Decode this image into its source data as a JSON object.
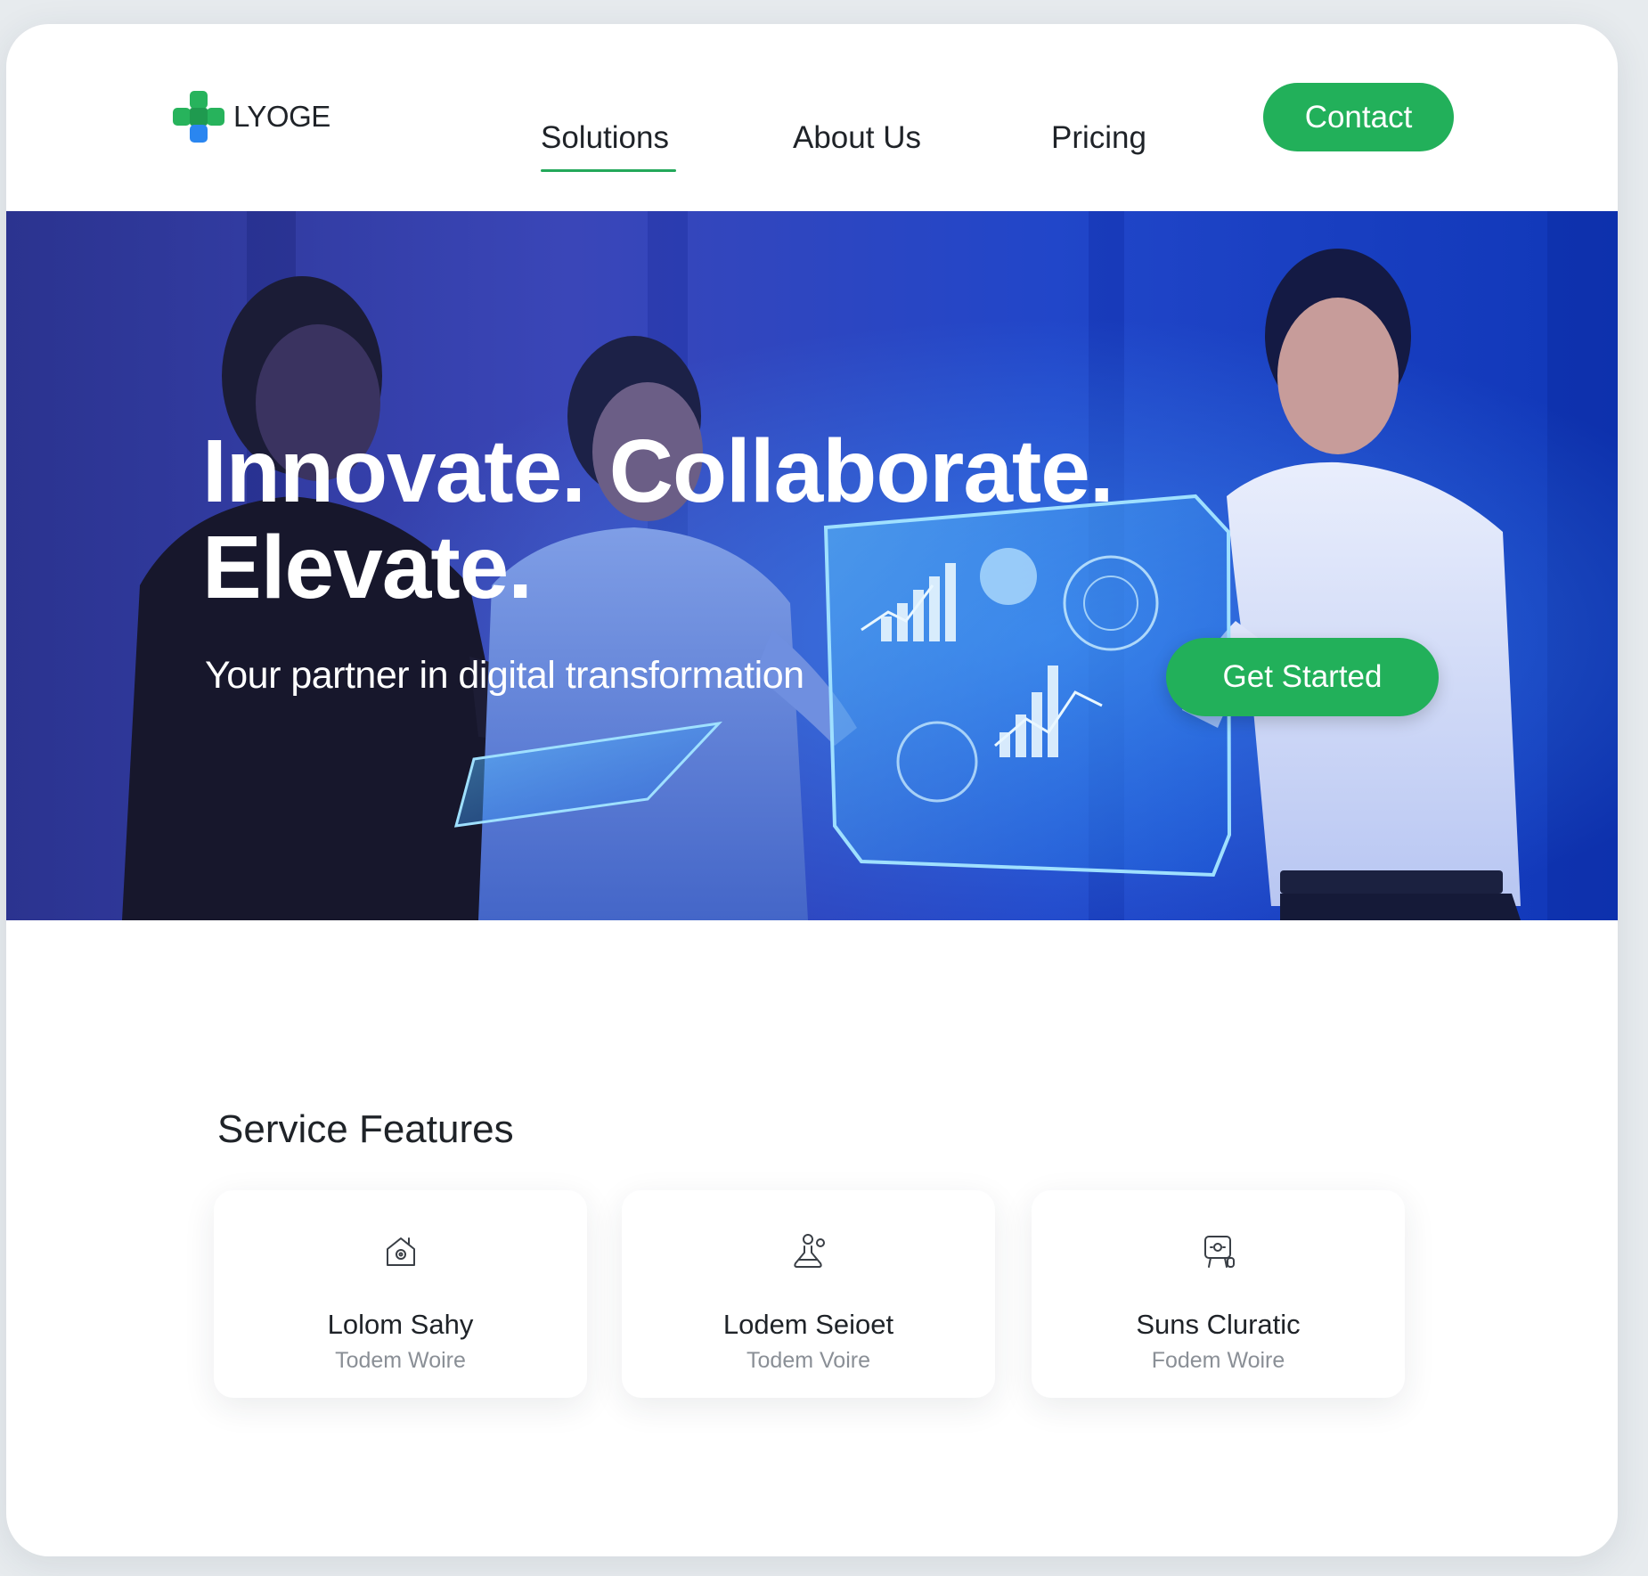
{
  "brand": {
    "name": "LYOGE",
    "logo_icon": "plus-cross-logo-icon",
    "logo_colors": [
      "#27b35c",
      "#2a86f0"
    ]
  },
  "nav": {
    "items": [
      {
        "label": "Solutions",
        "active": true
      },
      {
        "label": "About Us",
        "active": false
      },
      {
        "label": "Pricing",
        "active": false
      }
    ],
    "contact_label": "Contact"
  },
  "hero": {
    "title_line1": "Innovate. Collaborate.",
    "title_line2": "Elevate.",
    "subtitle": "Your partner in digital transformation",
    "cta_label": "Get Started",
    "image_icon": "team-hologram-photo"
  },
  "features": {
    "heading": "Service Features",
    "cards": [
      {
        "icon": "house-icon",
        "title": "Lolom Sahy",
        "desc": "Todem Woire"
      },
      {
        "icon": "user-flask-icon",
        "title": "Lodem Seioet",
        "desc": "Todem Voire"
      },
      {
        "icon": "device-settings-icon",
        "title": "Suns Cluratic",
        "desc": "Fodem Woire"
      }
    ]
  },
  "colors": {
    "accent": "#22b05a",
    "hero_blue": "#1f4ad6",
    "page_bg": "#e7ebee",
    "text": "#1f2328",
    "muted_text": "#8a8f96"
  }
}
